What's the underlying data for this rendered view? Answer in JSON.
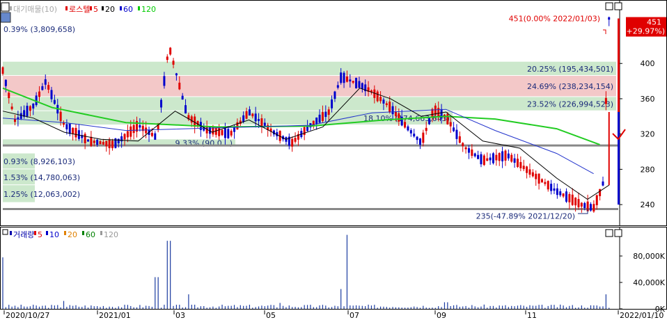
{
  "price_panel": {
    "legend": [
      {
        "text": "대기매물(10)",
        "color": "#aaaaaa"
      },
      {
        "text": "로스텔",
        "color": "#e00000"
      },
      {
        "text": "5",
        "color": "#e00000"
      },
      {
        "text": "20",
        "color": "#000000"
      },
      {
        "text": "60",
        "color": "#0000cc"
      },
      {
        "text": "120",
        "color": "#00cc00"
      }
    ],
    "max_note": "451(0.00% 2022/01/03)",
    "min_note": "235(-47.89% 2021/12/20)",
    "current_price": "451",
    "current_change": "(+29.97%)",
    "hline_price": 307,
    "hline_low": 235
  },
  "volume_panel": {
    "legend": [
      {
        "text": "거래량",
        "color": "#0000aa"
      },
      {
        "text": "5",
        "color": "#e00000"
      },
      {
        "text": "10",
        "color": "#0000cc"
      },
      {
        "text": "20",
        "color": "#e08000"
      },
      {
        "text": "60",
        "color": "#008000"
      },
      {
        "text": "120",
        "color": "#999999"
      }
    ]
  },
  "date_labels": [
    "2020/10/27",
    "2021/01",
    "03",
    "05",
    "07",
    "09",
    "11",
    "2022/01/10"
  ],
  "chart_data": [
    {
      "type": "candlestick",
      "ylim": [
        218,
        468
      ],
      "yticks": [
        240,
        280,
        320,
        360,
        400
      ],
      "overlap_bands": [
        {
          "price_low": 386,
          "price_high": 402,
          "label": "20.25% (195,434,501)",
          "color": "#cce8cc"
        },
        {
          "price_low": 362,
          "price_high": 386,
          "label": "24.69% (238,234,154)",
          "color": "#f3c8c8"
        },
        {
          "price_low": 346,
          "price_high": 362,
          "label": "23.52% (226,994,523)",
          "color": "#cce8cc"
        },
        {
          "price_low": 330,
          "price_high": 346,
          "label": "18.10% (174,663,643)",
          "color": "#cce8cc"
        },
        {
          "price_low": 306,
          "price_high": 314,
          "label": "9.33% (90,0…)",
          "color": "#cce8cc"
        },
        {
          "price_low": 280,
          "price_high": 298,
          "label": "0.93% (8,926,103)",
          "color": "#cce8cc"
        },
        {
          "price_low": 262,
          "price_high": 280,
          "label": "1.53% (14,780,063)",
          "color": "#cce8cc"
        },
        {
          "price_low": 242,
          "price_high": 262,
          "label": "1.25% (12,063,002)",
          "color": "#cce8cc"
        },
        {
          "price_low": 434,
          "price_high": 444,
          "label": "0.39% (3,809,658)",
          "color": "#ffffff"
        }
      ],
      "ma_legend": [
        "5",
        "20",
        "60",
        "120"
      ],
      "ma120_points": [
        [
          0,
          372
        ],
        [
          0.08,
          350
        ],
        [
          0.2,
          333
        ],
        [
          0.35,
          328
        ],
        [
          0.5,
          329
        ],
        [
          0.62,
          336
        ],
        [
          0.72,
          340
        ],
        [
          0.8,
          337
        ],
        [
          0.9,
          326
        ],
        [
          0.97,
          308
        ]
      ],
      "ma60_points": [
        [
          0,
          338
        ],
        [
          0.1,
          333
        ],
        [
          0.2,
          324
        ],
        [
          0.35,
          327
        ],
        [
          0.5,
          330
        ],
        [
          0.6,
          344
        ],
        [
          0.72,
          348
        ],
        [
          0.8,
          324
        ],
        [
          0.9,
          298
        ],
        [
          0.96,
          275
        ]
      ],
      "ma20_points": [
        [
          0,
          346
        ],
        [
          0.05,
          338
        ],
        [
          0.1,
          322
        ],
        [
          0.16,
          314
        ],
        [
          0.22,
          312
        ],
        [
          0.28,
          346
        ],
        [
          0.34,
          322
        ],
        [
          0.4,
          336
        ],
        [
          0.46,
          314
        ],
        [
          0.52,
          328
        ],
        [
          0.58,
          372
        ],
        [
          0.63,
          360
        ],
        [
          0.68,
          340
        ],
        [
          0.72,
          345
        ],
        [
          0.78,
          312
        ],
        [
          0.84,
          304
        ],
        [
          0.9,
          270
        ],
        [
          0.95,
          246
        ],
        [
          0.985,
          262
        ]
      ],
      "candles_trend": [
        [
          0,
          392
        ],
        [
          0.02,
          335
        ],
        [
          0.05,
          352
        ],
        [
          0.07,
          380
        ],
        [
          0.1,
          330
        ],
        [
          0.14,
          312
        ],
        [
          0.18,
          308
        ],
        [
          0.2,
          318
        ],
        [
          0.22,
          330
        ],
        [
          0.25,
          316
        ],
        [
          0.27,
          420
        ],
        [
          0.3,
          340
        ],
        [
          0.33,
          325
        ],
        [
          0.37,
          320
        ],
        [
          0.4,
          345
        ],
        [
          0.44,
          322
        ],
        [
          0.47,
          310
        ],
        [
          0.5,
          330
        ],
        [
          0.53,
          345
        ],
        [
          0.55,
          385
        ],
        [
          0.58,
          376
        ],
        [
          0.6,
          368
        ],
        [
          0.63,
          350
        ],
        [
          0.66,
          325
        ],
        [
          0.68,
          310
        ],
        [
          0.7,
          348
        ],
        [
          0.72,
          340
        ],
        [
          0.75,
          305
        ],
        [
          0.78,
          290
        ],
        [
          0.82,
          296
        ],
        [
          0.86,
          275
        ],
        [
          0.9,
          255
        ],
        [
          0.94,
          240
        ],
        [
          0.96,
          236
        ],
        [
          0.975,
          262
        ],
        [
          0.985,
          451
        ]
      ]
    },
    {
      "type": "bar",
      "ylim": [
        0,
        120000
      ],
      "yticks": [
        {
          "value": 0,
          "label": "0K"
        },
        {
          "value": 40000,
          "label": "40,000K"
        },
        {
          "value": 80000,
          "label": "80,000K"
        }
      ],
      "spikes": [
        [
          0.0,
          78000
        ],
        [
          0.1,
          12000
        ],
        [
          0.25,
          48000
        ],
        [
          0.27,
          103000
        ],
        [
          0.3,
          22000
        ],
        [
          0.45,
          9000
        ],
        [
          0.55,
          30000
        ],
        [
          0.56,
          112000
        ],
        [
          0.72,
          10000
        ],
        [
          0.98,
          22000
        ]
      ]
    }
  ]
}
